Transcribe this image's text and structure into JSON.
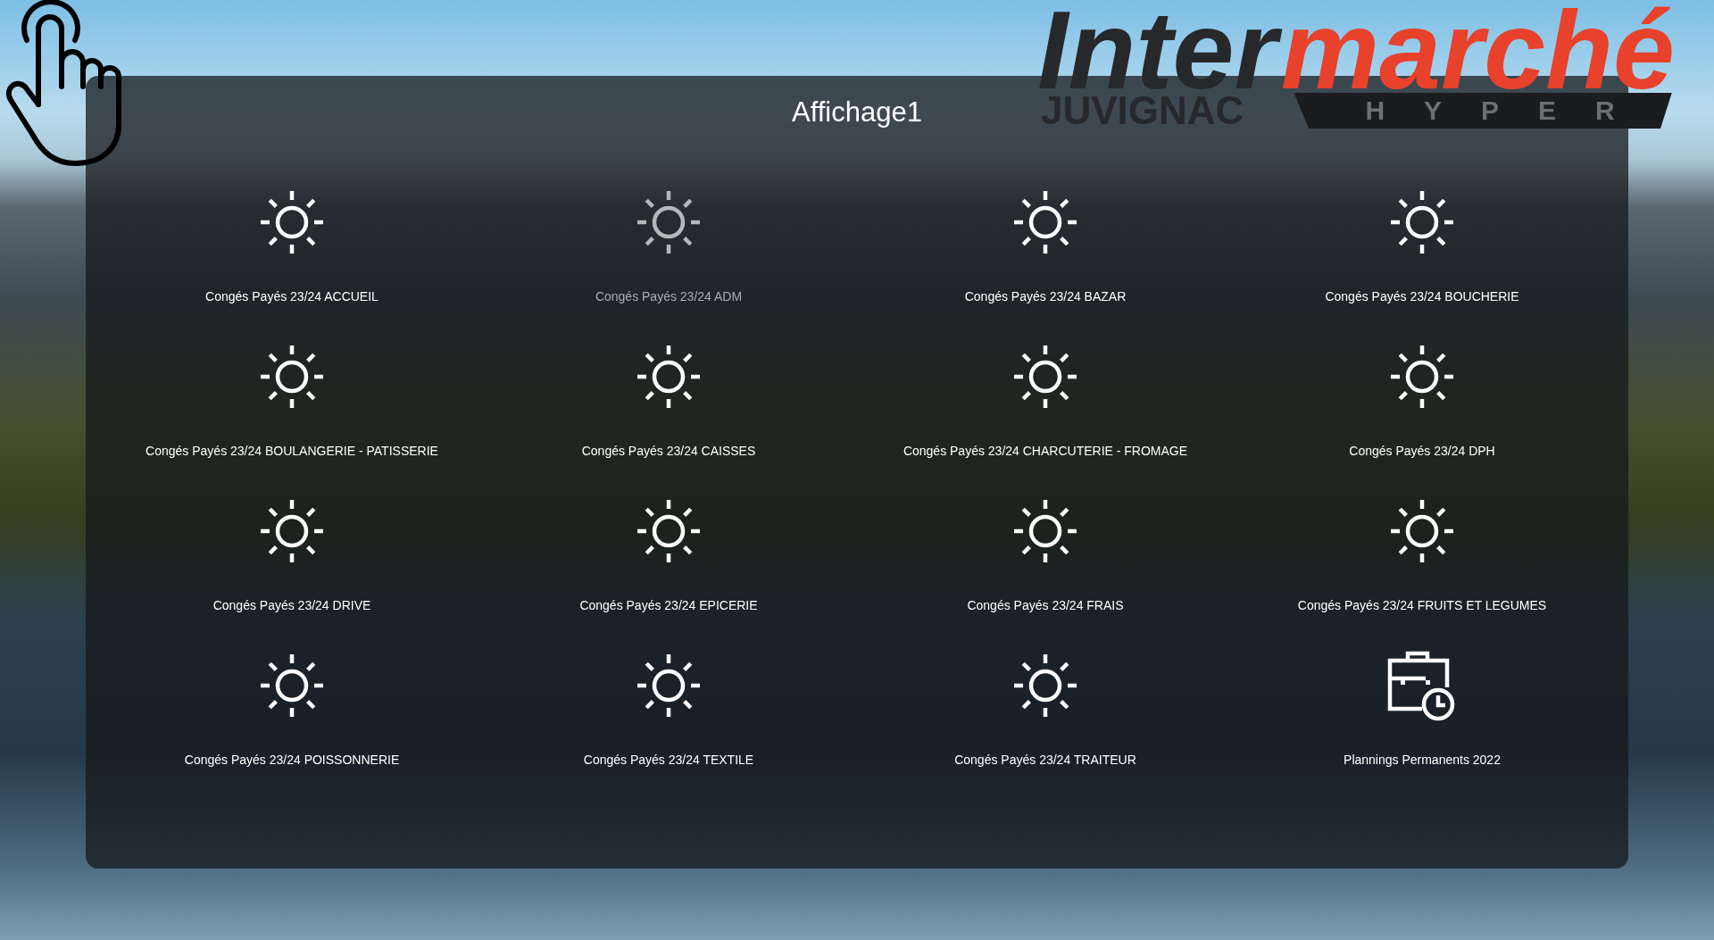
{
  "logo": {
    "brand_start": "Inter",
    "brand_end": "marché",
    "town": "JUVIGNAC",
    "store_format": "HYPER"
  },
  "panel": {
    "title": "Affichage1"
  },
  "tiles": [
    {
      "kind": "holiday",
      "label": "Congés Payés 23/24 ACCUEIL",
      "disabled": false
    },
    {
      "kind": "holiday",
      "label": "Congés Payés 23/24 ADM",
      "disabled": true
    },
    {
      "kind": "holiday",
      "label": "Congés Payés 23/24 BAZAR",
      "disabled": false
    },
    {
      "kind": "holiday",
      "label": "Congés Payés 23/24 BOUCHERIE",
      "disabled": false
    },
    {
      "kind": "holiday",
      "label": "Congés Payés 23/24 BOULANGERIE - PATISSERIE",
      "disabled": false
    },
    {
      "kind": "holiday",
      "label": "Congés Payés 23/24 CAISSES",
      "disabled": false
    },
    {
      "kind": "holiday",
      "label": "Congés Payés 23/24 CHARCUTERIE - FROMAGE",
      "disabled": false
    },
    {
      "kind": "holiday",
      "label": "Congés Payés 23/24 DPH",
      "disabled": false
    },
    {
      "kind": "holiday",
      "label": "Congés Payés 23/24 DRIVE",
      "disabled": false
    },
    {
      "kind": "holiday",
      "label": "Congés Payés 23/24 EPICERIE",
      "disabled": false
    },
    {
      "kind": "holiday",
      "label": "Congés Payés 23/24 FRAIS",
      "disabled": false
    },
    {
      "kind": "holiday",
      "label": "Congés Payés 23/24 FRUITS ET LEGUMES",
      "disabled": false
    },
    {
      "kind": "holiday",
      "label": "Congés Payés 23/24 POISSONNERIE",
      "disabled": false
    },
    {
      "kind": "holiday",
      "label": "Congés Payés 23/24 TEXTILE",
      "disabled": false
    },
    {
      "kind": "holiday",
      "label": "Congés Payés 23/24 TRAITEUR",
      "disabled": false
    },
    {
      "kind": "schedule",
      "label": "Plannings Permanents 2022",
      "disabled": false
    }
  ]
}
